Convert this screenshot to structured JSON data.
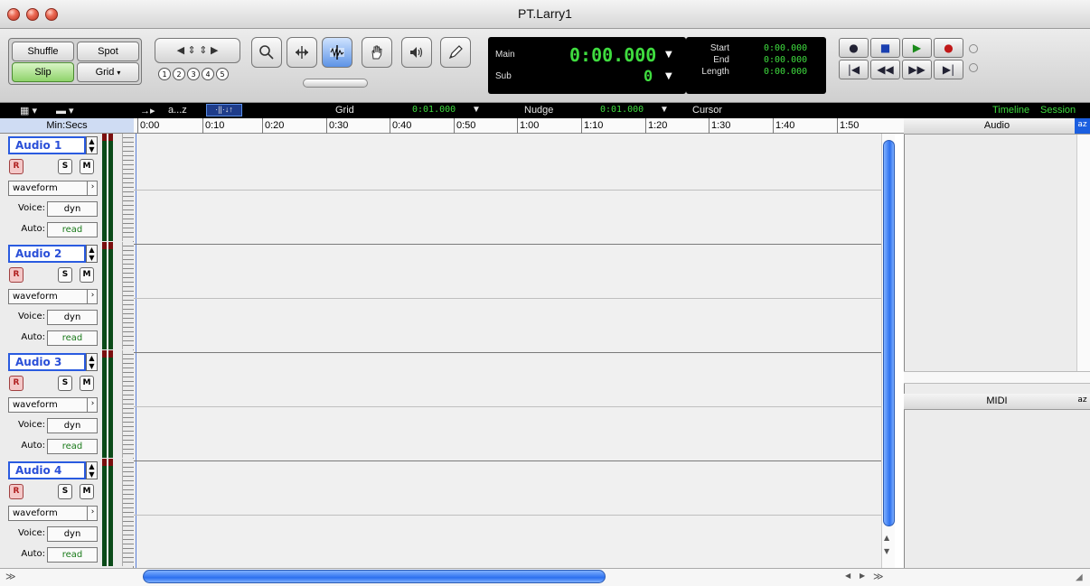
{
  "window": {
    "title": "PT.Larry1"
  },
  "toolbar": {
    "edit_modes": [
      "Shuffle",
      "Spot",
      "Slip",
      "Grid"
    ],
    "active_mode": "Slip",
    "zoom_presets": [
      "1",
      "2",
      "3",
      "4",
      "5"
    ]
  },
  "counter": {
    "main_label": "Main",
    "main_value": "0:00.000",
    "sub_label": "Sub",
    "sub_value": "0",
    "start_label": "Start",
    "end_label": "End",
    "length_label": "Length",
    "start_value": "0:00.000",
    "end_value": "0:00.000",
    "length_value": "0:00.000"
  },
  "subbar": {
    "sort_label": "a...z",
    "grid_label": "Grid",
    "grid_value": "0:01.000",
    "nudge_label": "Nudge",
    "nudge_value": "0:01.000",
    "cursor_label": "Cursor",
    "timeline_label": "Timeline",
    "session_label": "Session"
  },
  "ruler": {
    "label": "Min:Secs",
    "ticks": [
      "0:00",
      "0:10",
      "0:20",
      "0:30",
      "0:40",
      "0:50",
      "1:00",
      "1:10",
      "1:20",
      "1:30",
      "1:40",
      "1:50"
    ]
  },
  "tracks": [
    {
      "name": "Audio 1",
      "rec": "R",
      "solo": "S",
      "mute": "M",
      "view": "waveform",
      "voice_label": "Voice:",
      "voice": "dyn",
      "auto_label": "Auto:",
      "auto": "read"
    },
    {
      "name": "Audio 2",
      "rec": "R",
      "solo": "S",
      "mute": "M",
      "view": "waveform",
      "voice_label": "Voice:",
      "voice": "dyn",
      "auto_label": "Auto:",
      "auto": "read"
    },
    {
      "name": "Audio 3",
      "rec": "R",
      "solo": "S",
      "mute": "M",
      "view": "waveform",
      "voice_label": "Voice:",
      "voice": "dyn",
      "auto_label": "Auto:",
      "auto": "read"
    },
    {
      "name": "Audio 4",
      "rec": "R",
      "solo": "S",
      "mute": "M",
      "view": "waveform",
      "voice_label": "Voice:",
      "voice": "dyn",
      "auto_label": "Auto:",
      "auto": "read"
    }
  ],
  "panels": {
    "audio_title": "Audio",
    "midi_title": "MIDI",
    "sort_icon": "az"
  }
}
